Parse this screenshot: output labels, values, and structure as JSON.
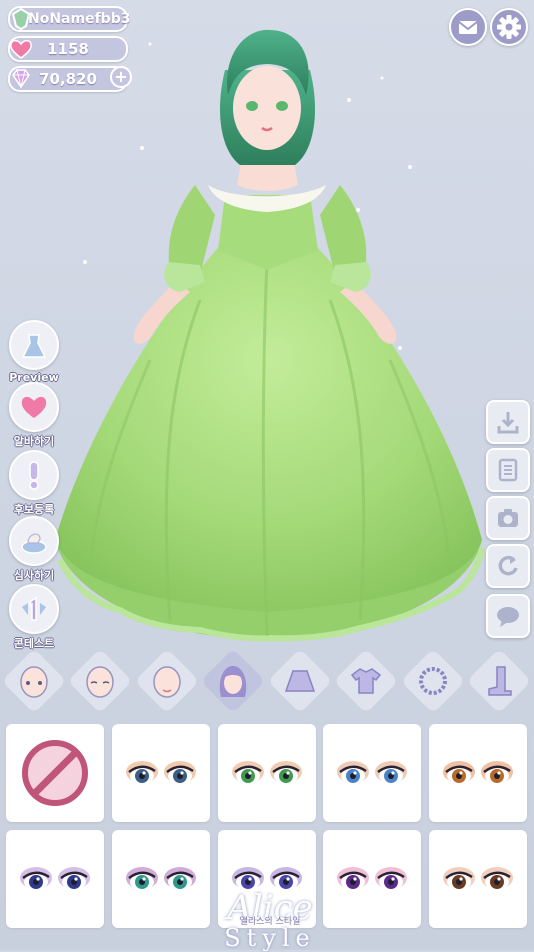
{
  "status": {
    "username": "NoNamefbb3",
    "hearts": "1158",
    "gems": "70,820",
    "add_gems_icon": "plus-circle-icon"
  },
  "top_buttons": [
    {
      "name": "mail",
      "icon": "envelope-icon"
    },
    {
      "name": "settings",
      "icon": "gear-icon"
    }
  ],
  "side_menu": [
    {
      "label": "Preview",
      "icon": "dress-preview-icon"
    },
    {
      "label": "알바하기",
      "icon": "heart-icon"
    },
    {
      "label": "후보등록",
      "icon": "exclamation-icon"
    },
    {
      "label": "심사하기",
      "icon": "judge-icon"
    },
    {
      "label": "콘테스트",
      "icon": "first-place-icon"
    }
  ],
  "tools": [
    {
      "name": "download",
      "icon": "download-icon"
    },
    {
      "name": "list",
      "icon": "list-icon"
    },
    {
      "name": "camera",
      "icon": "camera-icon"
    },
    {
      "name": "reset",
      "icon": "undo-icon"
    },
    {
      "name": "chat",
      "icon": "speech-bubble-icon"
    }
  ],
  "categories": [
    {
      "name": "face",
      "icon": "face-shape-icon",
      "active": false
    },
    {
      "name": "face-closed-eyes",
      "icon": "face-eyes-icon",
      "active": false
    },
    {
      "name": "face-mouth",
      "icon": "face-mouth-icon",
      "active": false
    },
    {
      "name": "hair",
      "icon": "hair-icon",
      "active": true
    },
    {
      "name": "skirt",
      "icon": "skirt-icon",
      "active": false
    },
    {
      "name": "top",
      "icon": "shirt-icon",
      "active": false
    },
    {
      "name": "accessory",
      "icon": "necklace-icon",
      "active": false
    },
    {
      "name": "shoes",
      "icon": "boot-icon",
      "active": false
    }
  ],
  "eye_items": [
    {
      "name": "none",
      "iris": null
    },
    {
      "name": "eyes-blue-dark",
      "iris": "#3b5f86",
      "shadow": "#e4a06a"
    },
    {
      "name": "eyes-green",
      "iris": "#3f9a4e",
      "shadow": "#e6a277"
    },
    {
      "name": "eyes-blue",
      "iris": "#4a84c6",
      "shadow": "#e0a07e"
    },
    {
      "name": "eyes-amber",
      "iris": "#b86a2a",
      "shadow": "#e48a5a"
    },
    {
      "name": "eyes-indigo",
      "iris": "#2f3a8c",
      "shadow": "#b28ad6"
    },
    {
      "name": "eyes-teal",
      "iris": "#2f9a8c",
      "shadow": "#a86ab8"
    },
    {
      "name": "eyes-violet",
      "iris": "#4b45a8",
      "shadow": "#9a7acc"
    },
    {
      "name": "eyes-purple",
      "iris": "#5b2a8c",
      "shadow": "#e28ab6"
    },
    {
      "name": "eyes-brown",
      "iris": "#6a3a22",
      "shadow": "#e6a888"
    }
  ],
  "logo": {
    "title": "Alice",
    "subtitle": "앨리스의 스타일",
    "style": "Style"
  },
  "colors": {
    "pill": "#c4c5df",
    "dress": "#a8dc7c",
    "hair": "#3f9a72",
    "none_icon": "#c0557a"
  }
}
